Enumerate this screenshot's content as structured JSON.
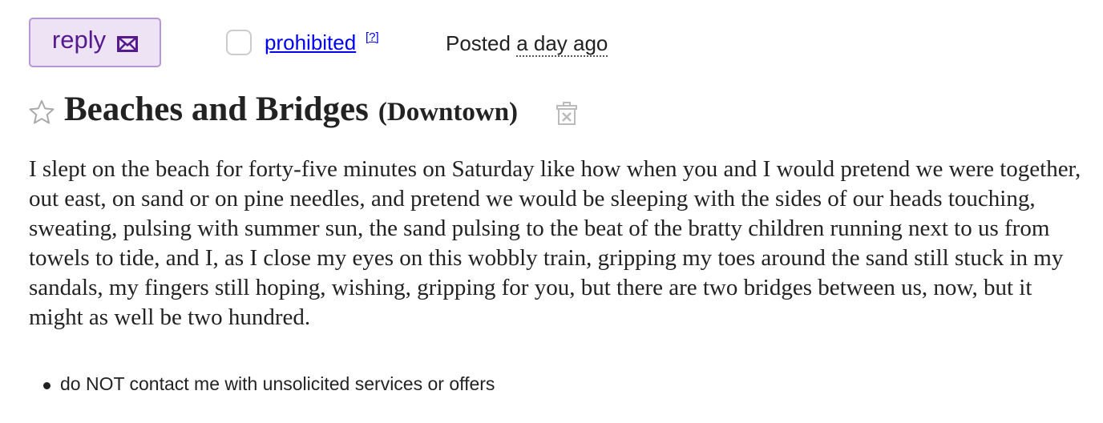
{
  "header": {
    "reply_label": "reply",
    "reply_icon": "envelope-icon",
    "prohibited_label": "prohibited",
    "help_label": "[?]",
    "posted_label": "Posted",
    "posted_time": "a day ago"
  },
  "posting": {
    "favorite_icon": "star-outline-icon",
    "title": "Beaches and Bridges",
    "location": "(Downtown)",
    "hide_icon": "trash-x-icon",
    "body": "I slept on the beach for forty-five minutes on Saturday like how when you and I would pretend we were together, out east, on sand or on pine needles, and pretend we would be sleeping with the sides of our heads touching, sweating, pulsing with summer sun, the sand pulsing to the beat of the bratty children running next to us from towels to tide, and I, as I close my eyes on this wobbly train, gripping my toes around the sand still stuck in my sandals, my fingers still hoping, wishing, gripping for you, but there are two bridges between us, now, but it might as well be two hundred."
  },
  "notices": [
    "do NOT contact me with unsolicited services or offers"
  ],
  "colors": {
    "reply_bg": "#eee3f5",
    "reply_border": "#b497d4",
    "reply_text": "#551a8b",
    "link": "#0000ee",
    "text": "#222222"
  }
}
